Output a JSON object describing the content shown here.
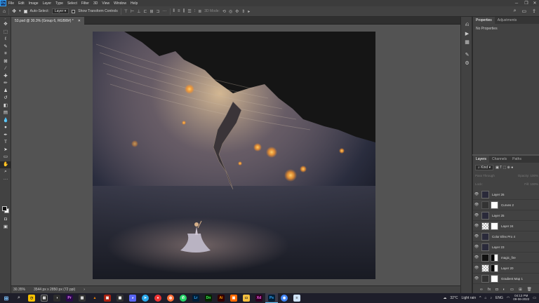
{
  "app": {
    "logo": "Ps"
  },
  "menubar": {
    "items": [
      "File",
      "Edit",
      "Image",
      "Layer",
      "Type",
      "Select",
      "Filter",
      "3D",
      "View",
      "Window",
      "Help"
    ]
  },
  "window_controls": {
    "minimize_icon": "minimize-icon",
    "restore_icon": "restore-icon",
    "close_icon": "close-icon"
  },
  "options_bar": {
    "auto_select_label": "Auto-Select:",
    "auto_select_value": "Layer",
    "transform_label": "Show Transform Controls",
    "mode_label": "3D Mode:"
  },
  "document": {
    "tab_title": "53.psd @ 30.3% (Group 6, RGB/8#) *",
    "zoom": "30.35%",
    "dimensions": "3544 px x 2850 px (72 ppi)"
  },
  "properties_panel": {
    "tabs": [
      "Properties",
      "Adjustments"
    ],
    "content": "No Properties"
  },
  "layers_panel": {
    "tabs": [
      "Layers",
      "Channels",
      "Paths"
    ],
    "filter_label": "Kind",
    "blend_mode": "Pass Through",
    "opacity_label": "Opacity:",
    "opacity_value": "100%",
    "lock_label": "Lock:",
    "fill_label": "Fill:",
    "fill_value": "100%",
    "layers": [
      {
        "name": "Layer 26"
      },
      {
        "name": "Curves 2"
      },
      {
        "name": "Layer 25"
      },
      {
        "name": "Layer 24"
      },
      {
        "name": "Color Efex Pro 4"
      },
      {
        "name": "Layer 23"
      },
      {
        "name": "magic_fire"
      },
      {
        "name": "Layer 20"
      },
      {
        "name": "Gradient Map 1"
      }
    ]
  },
  "taskbar": {
    "weather_temp": "32°C",
    "weather_desc": "Light rain",
    "language": "ENG",
    "time": "04:13 PM",
    "date": "09-06-2022"
  },
  "colors": {
    "ui_dark": "#424242",
    "canvas_bg": "#535353",
    "ps_blue": "#31a8ff"
  }
}
